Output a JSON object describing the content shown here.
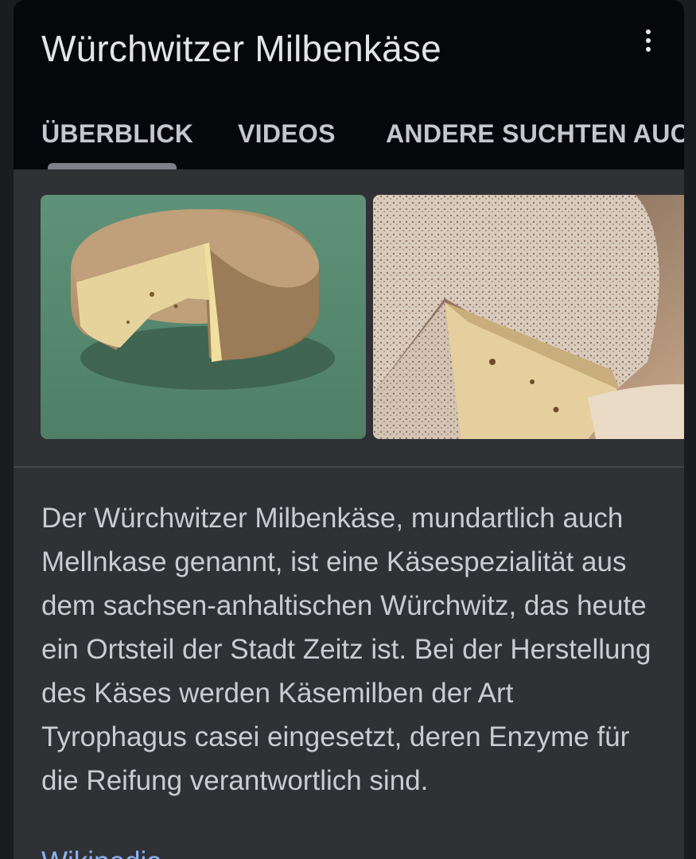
{
  "header": {
    "title": "Würchwitzer Milbenkäse"
  },
  "tabs": [
    {
      "label": "ÜBERBLICK",
      "selected": true
    },
    {
      "label": "VIDEOS",
      "selected": false
    },
    {
      "label": "ANDERE SUCHTEN AUCH",
      "selected": false
    }
  ],
  "description": {
    "text": "Der Würchwitzer Milbenkäse, mundartlich auch Mellnkase genannt, ist eine Käsespezialität aus dem sachsen-anhaltischen Würchwitz, das heute ein Ortsteil der Stadt Zeitz ist. Bei der Herstellung des Käses werden Käsemilben der Art Tyrophagus casei eingesetzt, deren Enzyme für die Reifung verantwortlich sind.",
    "source_link": "Wikipedia"
  },
  "colors": {
    "page_background": "#1b1c1f",
    "card_background": "#303134",
    "header_background": "#05070b",
    "link": "#8ab4f8"
  },
  "icons": {
    "menu": "more-vert-icon"
  }
}
